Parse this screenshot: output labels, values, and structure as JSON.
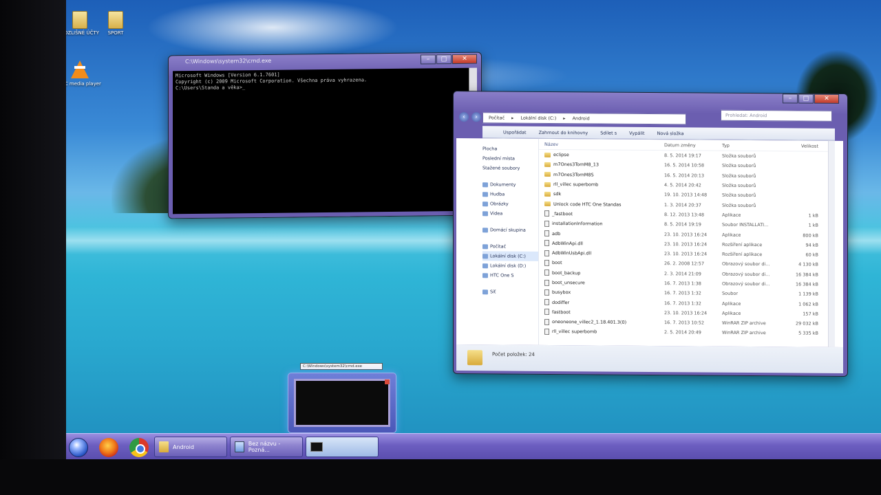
{
  "desktop": {
    "icons": [
      {
        "label": "ROZLIŠNÉ ÚČTY",
        "icon": "folder-icon"
      },
      {
        "label": "SPORT",
        "icon": "folder-icon"
      },
      {
        "label": "VLC media player",
        "icon": "vlc-icon"
      }
    ]
  },
  "console": {
    "title": "C:\\Windows\\system32\\cmd.exe",
    "lines": [
      "Microsoft Windows [Version 6.1.7601]",
      "Copyright (c) 2009 Microsoft Corporation. Všechna práva vyhrazena.",
      "",
      "C:\\Users\\Standa a věka>_"
    ]
  },
  "explorer": {
    "breadcrumb": [
      "Počítač",
      "Lokální disk (C:)",
      "Android"
    ],
    "search_placeholder": "Prohledat: Android",
    "toolbar": [
      "Uspořádat",
      "Zahrnout do knihovny",
      "Sdílet s",
      "Vypálit",
      "Nová složka"
    ],
    "nav": {
      "favorites": [
        "Plocha",
        "Poslední místa",
        "Stažené soubory"
      ],
      "libraries": [
        "Dokumenty",
        "Hudba",
        "Obrázky",
        "Videa"
      ],
      "homegroup": "Domácí skupina",
      "computer": "Počítač",
      "drives": [
        "Lokální disk (C:)",
        "Lokální disk (D:)",
        "HTC One S"
      ],
      "network": "Síť"
    },
    "columns": {
      "name": "Název",
      "date": "Datum změny",
      "type": "Typ",
      "size": "Velikost"
    },
    "rows": [
      {
        "name": "eclipse",
        "date": "8. 5. 2014 19:17",
        "type": "Složka souborů",
        "size": "",
        "kind": "folder"
      },
      {
        "name": "m7Ones3TornM8_13",
        "date": "16. 5. 2014 10:58",
        "type": "Složka souborů",
        "size": "",
        "kind": "folder"
      },
      {
        "name": "m7Ones3TornM8S",
        "date": "16. 5. 2014 20:13",
        "type": "Složka souborů",
        "size": "",
        "kind": "folder"
      },
      {
        "name": "rll_villec superbomb",
        "date": "4. 5. 2014 20:42",
        "type": "Složka souborů",
        "size": "",
        "kind": "folder"
      },
      {
        "name": "sdk",
        "date": "19. 10. 2013 14:48",
        "type": "Složka souborů",
        "size": "",
        "kind": "folder"
      },
      {
        "name": "Unlock code HTC One Standas",
        "date": "1. 3. 2014 20:37",
        "type": "Složka souborů",
        "size": "",
        "kind": "folder"
      },
      {
        "name": "_fastboot",
        "date": "8. 12. 2013 13:48",
        "type": "Aplikace",
        "size": "1 kB",
        "kind": "file"
      },
      {
        "name": "installationInformation",
        "date": "8. 5. 2014 19:19",
        "type": "Soubor INSTALLATI...",
        "size": "1 kB",
        "kind": "file"
      },
      {
        "name": "adb",
        "date": "23. 10. 2013 16:24",
        "type": "Aplikace",
        "size": "800 kB",
        "kind": "file"
      },
      {
        "name": "AdbWinApi.dll",
        "date": "23. 10. 2013 16:24",
        "type": "Rozšíření aplikace",
        "size": "94 kB",
        "kind": "file"
      },
      {
        "name": "AdbWinUsbApi.dll",
        "date": "23. 10. 2013 16:24",
        "type": "Rozšíření aplikace",
        "size": "60 kB",
        "kind": "file"
      },
      {
        "name": "boot",
        "date": "26. 2. 2008 12:57",
        "type": "Obrazový soubor di...",
        "size": "4 130 kB",
        "kind": "file"
      },
      {
        "name": "boot_backup",
        "date": "2. 3. 2014 21:09",
        "type": "Obrazový soubor di...",
        "size": "16 384 kB",
        "kind": "file"
      },
      {
        "name": "boot_unsecure",
        "date": "16. 7. 2013 1:38",
        "type": "Obrazový soubor di...",
        "size": "16 384 kB",
        "kind": "file"
      },
      {
        "name": "busybox",
        "date": "16. 7. 2013 1:32",
        "type": "Soubor",
        "size": "1 139 kB",
        "kind": "file"
      },
      {
        "name": "dodiffer",
        "date": "16. 7. 2013 1:32",
        "type": "Aplikace",
        "size": "1 062 kB",
        "kind": "file"
      },
      {
        "name": "fastboot",
        "date": "23. 10. 2013 16:24",
        "type": "Aplikace",
        "size": "157 kB",
        "kind": "file"
      },
      {
        "name": "oneoneone_villec2_1.18.401.3(0)",
        "date": "16. 7. 2013 10:52",
        "type": "WinRAR ZIP archive",
        "size": "29 032 kB",
        "kind": "file"
      },
      {
        "name": "rll_villec superbomb",
        "date": "2. 5. 2014 20:49",
        "type": "WinRAR ZIP archive",
        "size": "5 335 kB",
        "kind": "file"
      }
    ],
    "status": "Počet položek: 24"
  },
  "thumbnail": {
    "title": "C:\\Windows\\system32\\cmd.exe"
  },
  "taskbar": {
    "tasks": [
      {
        "label": "Android",
        "icon": "folder-icon"
      },
      {
        "label": "Bez názvu - Pozná...",
        "icon": "notepad-icon"
      },
      {
        "label": "",
        "icon": "cmd-icon"
      }
    ]
  },
  "colors": {
    "accent": "#6c5ec0",
    "console_bg": "#000000",
    "taskbar": "#6c5ec0"
  }
}
